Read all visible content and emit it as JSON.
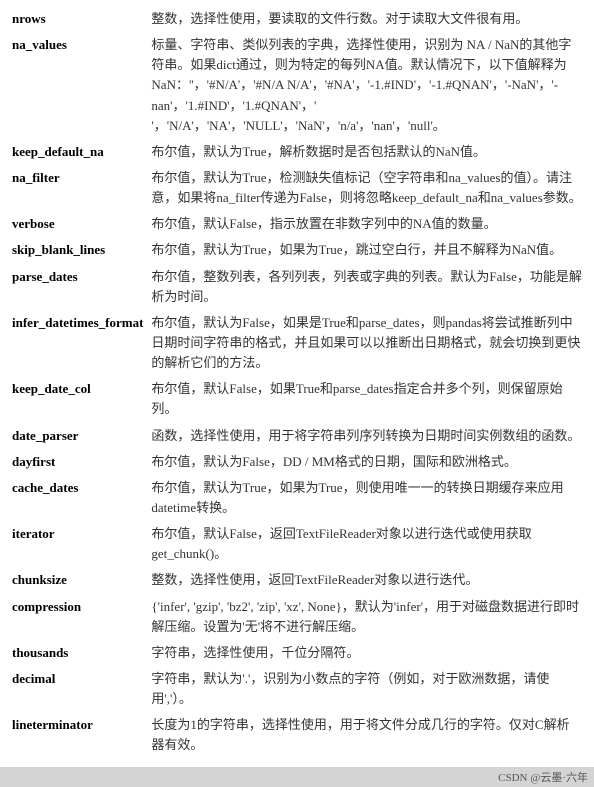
{
  "params": [
    {
      "name": "nrows",
      "desc": "整数，选择性使用，要读取的文件行数。对于读取大文件很有用。"
    },
    {
      "name": "na_values",
      "desc": "标量、字符串、类似列表的字典，选择性使用，识别为 NA / NaN的其他字符串。如果dict通过，则为特定的每列NA值。默认情况下，以下值解释为NaN：''，'#N/A'，'#N/A N/A'，'#NA'，'-1.#IND'，'-1.#QNAN'，'-NaN'，'-nan'，'1.#IND'，'1.#QNAN'，' '，'N/A'，'NA'，'NULL'，'NaN'，'n/a'，'nan'，'null'。"
    },
    {
      "name": "keep_default_na",
      "desc": "布尔值，默认为True，解析数据时是否包括默认的NaN值。"
    },
    {
      "name": "na_filter",
      "desc": "布尔值，默认为True，检测缺失值标记（空字符串和na_values的值）。请注意，如果将na_filter传递为False，则将忽略keep_default_na和na_values参数。"
    },
    {
      "name": "verbose",
      "desc": "布尔值，默认False，指示放置在非数字列中的NA值的数量。"
    },
    {
      "name": "skip_blank_lines",
      "desc": "布尔值，默认为True，如果为True，跳过空白行，并且不解释为NaN值。"
    },
    {
      "name": "parse_dates",
      "desc": "布尔值，整数列表，各列列表，列表或字典的列表。默认为False，功能是解析为时间。"
    },
    {
      "name": "infer_datetimes_format",
      "desc": "布尔值，默认为False，如果是True和parse_dates，则pandas将尝试推断列中日期时间字符串的格式，并且如果可以以推断出日期格式，就会切换到更快的解析它们的方法。"
    },
    {
      "name": "keep_date_col",
      "desc": "布尔值，默认False，如果True和parse_dates指定合并多个列，则保留原始列。"
    },
    {
      "name": "date_parser",
      "desc": "函数，选择性使用，用于将字符串列序列转换为日期时间实例数组的函数。"
    },
    {
      "name": "dayfirst",
      "desc": "布尔值，默认为False，DD / MM格式的日期，国际和欧洲格式。"
    },
    {
      "name": "cache_dates",
      "desc": "布尔值，默认为True，如果为True，则使用唯一一的转换日期缓存来应用datetime转换。"
    },
    {
      "name": "iterator",
      "desc": "布尔值，默认False，返回TextFileReader对象以进行迭代或使用获取 get_chunk()。"
    },
    {
      "name": "chunksize",
      "desc": "整数，选择性使用，返回TextFileReader对象以进行迭代。"
    },
    {
      "name": "compression",
      "desc": "{'infer', 'gzip', 'bz2', 'zip', 'xz', None}，默认为'infer'，用于对磁盘数据进行即时解压缩。设置为'无'将不进行解压缩。"
    },
    {
      "name": "thousands",
      "desc": "字符串，选择性使用，千位分隔符。"
    },
    {
      "name": "decimal",
      "desc": "字符串，默认为'.'，识别为小数点的字符（例如，对于欧洲数据，请使用','）。"
    },
    {
      "name": "lineterminator",
      "desc": "长度为1的字符串，选择性使用，用于将文件分成几行的字符。仅对C解析器有效。"
    }
  ],
  "footer": {
    "author": "CSDN @云墨·六年",
    "text": "CSDN @云墨·六年"
  }
}
